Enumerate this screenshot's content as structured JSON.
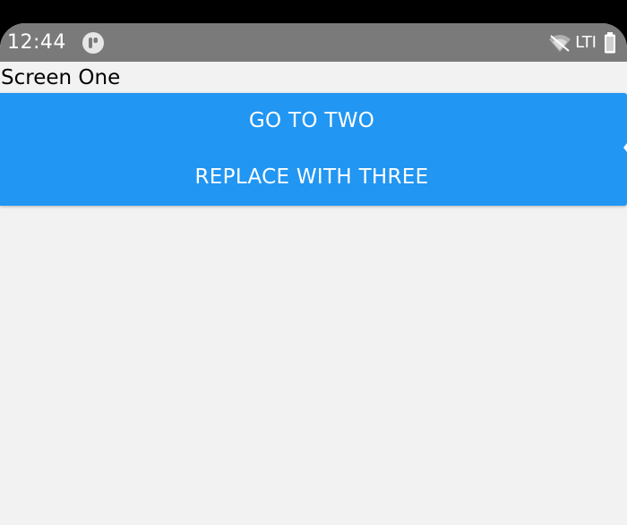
{
  "status_bar": {
    "time": "12:44",
    "app_icon": "notification-app-icon",
    "wifi_icon": "wifi-off-icon",
    "network": "LTI",
    "battery_icon": "battery-icon"
  },
  "screen": {
    "title": "Screen One"
  },
  "buttons": {
    "go_to_two": "GO TO TWO",
    "replace_with_three": "REPLACE WITH THREE"
  },
  "colors": {
    "accent": "#2196f3",
    "background": "#f2f2f2",
    "status_bar": "#7a7a7a"
  }
}
